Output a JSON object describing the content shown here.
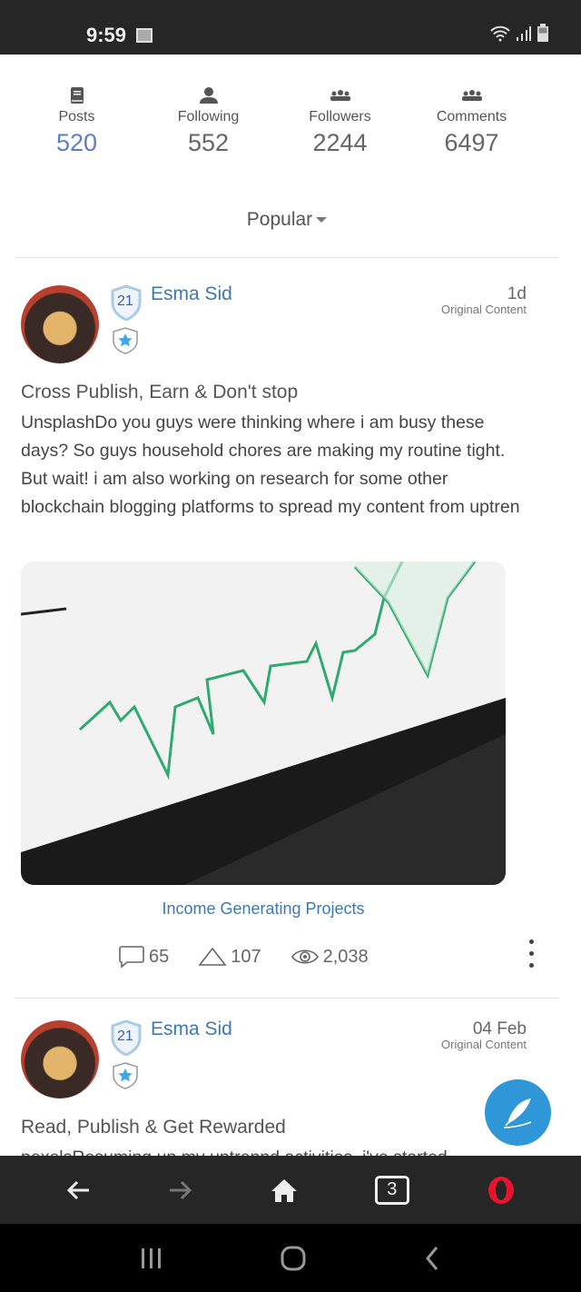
{
  "status_bar": {
    "time": "9:59"
  },
  "stats": [
    {
      "label": "Posts",
      "value": "520",
      "icon": "book-icon"
    },
    {
      "label": "Following",
      "value": "552",
      "icon": "user-icon"
    },
    {
      "label": "Followers",
      "value": "2244",
      "icon": "group-icon"
    },
    {
      "label": "Comments",
      "value": "6497",
      "icon": "group-icon"
    }
  ],
  "sort": {
    "selected": "Popular"
  },
  "posts": [
    {
      "author": "Esma Sid",
      "level": "21",
      "time": "1d",
      "tag": "Original Content",
      "title": "Cross Publish, Earn & Don't stop",
      "body": "UnsplashDo you guys were thinking where i am busy these days? So guys household chores are making my routine tight. But wait! i am also working on research for some other blockchain blogging platforms to spread my content from uptren",
      "category": "Income Generating Projects",
      "comments": "65",
      "upvotes": "107",
      "views": "2,038"
    },
    {
      "author": "Esma Sid",
      "level": "21",
      "time": "04 Feb",
      "tag": "Original Content",
      "title": "Read, Publish & Get Rewarded",
      "body": "pexelsResuming up my uptrennd activities, i've started"
    }
  ],
  "browser_nav": {
    "tabs_count": "3"
  },
  "colors": {
    "accent": "#3d78b3",
    "fab": "#2f96d8",
    "posts_value": "#5a7fc4"
  }
}
